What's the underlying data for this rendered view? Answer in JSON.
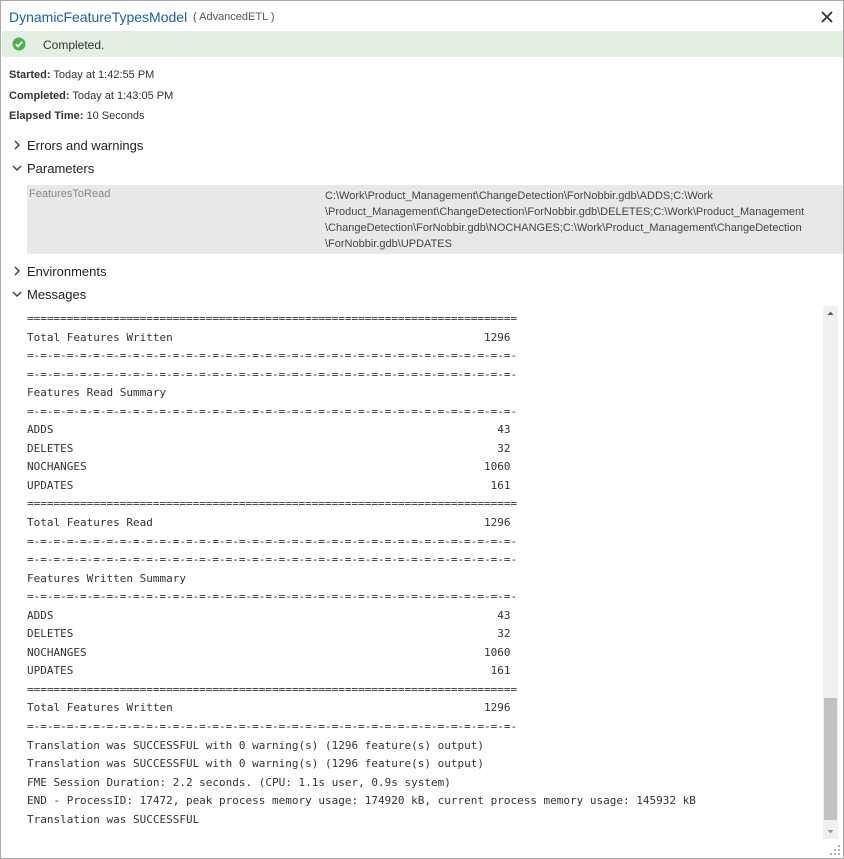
{
  "window": {
    "title": "DynamicFeatureTypesModel",
    "subtitle": "( AdvancedETL )"
  },
  "status": {
    "text": "Completed.",
    "color": "#4caf50"
  },
  "meta": {
    "started_label": "Started:",
    "started_value": "Today at 1:42:55 PM",
    "completed_label": "Completed:",
    "completed_value": "Today at 1:43:05 PM",
    "elapsed_label": "Elapsed Time:",
    "elapsed_value": "10 Seconds"
  },
  "sections": {
    "errors": "Errors and warnings",
    "parameters": "Parameters",
    "environments": "Environments",
    "messages": "Messages"
  },
  "parameters": [
    {
      "name": "FeaturesToRead",
      "value": "C:\\Work\\Product_Management\\ChangeDetection\\ForNobbir.gdb\\ADDS;C:\\Work\n\\Product_Management\\ChangeDetection\\ForNobbir.gdb\\DELETES;C:\\Work\\Product_Management\n\\ChangeDetection\\ForNobbir.gdb\\NOCHANGES;C:\\Work\\Product_Management\\ChangeDetection\n\\ForNobbir.gdb\\UPDATES"
    }
  ],
  "log_lines": [
    "==========================================================================",
    "Total Features Written                                               1296",
    "=-=-=-=-=-=-=-=-=-=-=-=-=-=-=-=-=-=-=-=-=-=-=-=-=-=-=-=-=-=-=-=-=-=-=-=-=-",
    "=-=-=-=-=-=-=-=-=-=-=-=-=-=-=-=-=-=-=-=-=-=-=-=-=-=-=-=-=-=-=-=-=-=-=-=-=-",
    "Features Read Summary",
    "=-=-=-=-=-=-=-=-=-=-=-=-=-=-=-=-=-=-=-=-=-=-=-=-=-=-=-=-=-=-=-=-=-=-=-=-=-",
    "ADDS                                                                   43",
    "DELETES                                                                32",
    "NOCHANGES                                                            1060",
    "UPDATES                                                               161",
    "==========================================================================",
    "Total Features Read                                                  1296",
    "=-=-=-=-=-=-=-=-=-=-=-=-=-=-=-=-=-=-=-=-=-=-=-=-=-=-=-=-=-=-=-=-=-=-=-=-=-",
    "=-=-=-=-=-=-=-=-=-=-=-=-=-=-=-=-=-=-=-=-=-=-=-=-=-=-=-=-=-=-=-=-=-=-=-=-=-",
    "Features Written Summary",
    "=-=-=-=-=-=-=-=-=-=-=-=-=-=-=-=-=-=-=-=-=-=-=-=-=-=-=-=-=-=-=-=-=-=-=-=-=-",
    "ADDS                                                                   43",
    "DELETES                                                                32",
    "NOCHANGES                                                            1060",
    "UPDATES                                                               161",
    "==========================================================================",
    "Total Features Written                                               1296",
    "=-=-=-=-=-=-=-=-=-=-=-=-=-=-=-=-=-=-=-=-=-=-=-=-=-=-=-=-=-=-=-=-=-=-=-=-=-",
    "Translation was SUCCESSFUL with 0 warning(s) (1296 feature(s) output)",
    "Translation was SUCCESSFUL with 0 warning(s) (1296 feature(s) output)",
    "FME Session Duration: 2.2 seconds. (CPU: 1.1s user, 0.9s system)",
    "END - ProcessID: 17472, peak process memory usage: 174920 kB, current process memory usage: 145932 kB",
    "Translation was SUCCESSFUL"
  ]
}
